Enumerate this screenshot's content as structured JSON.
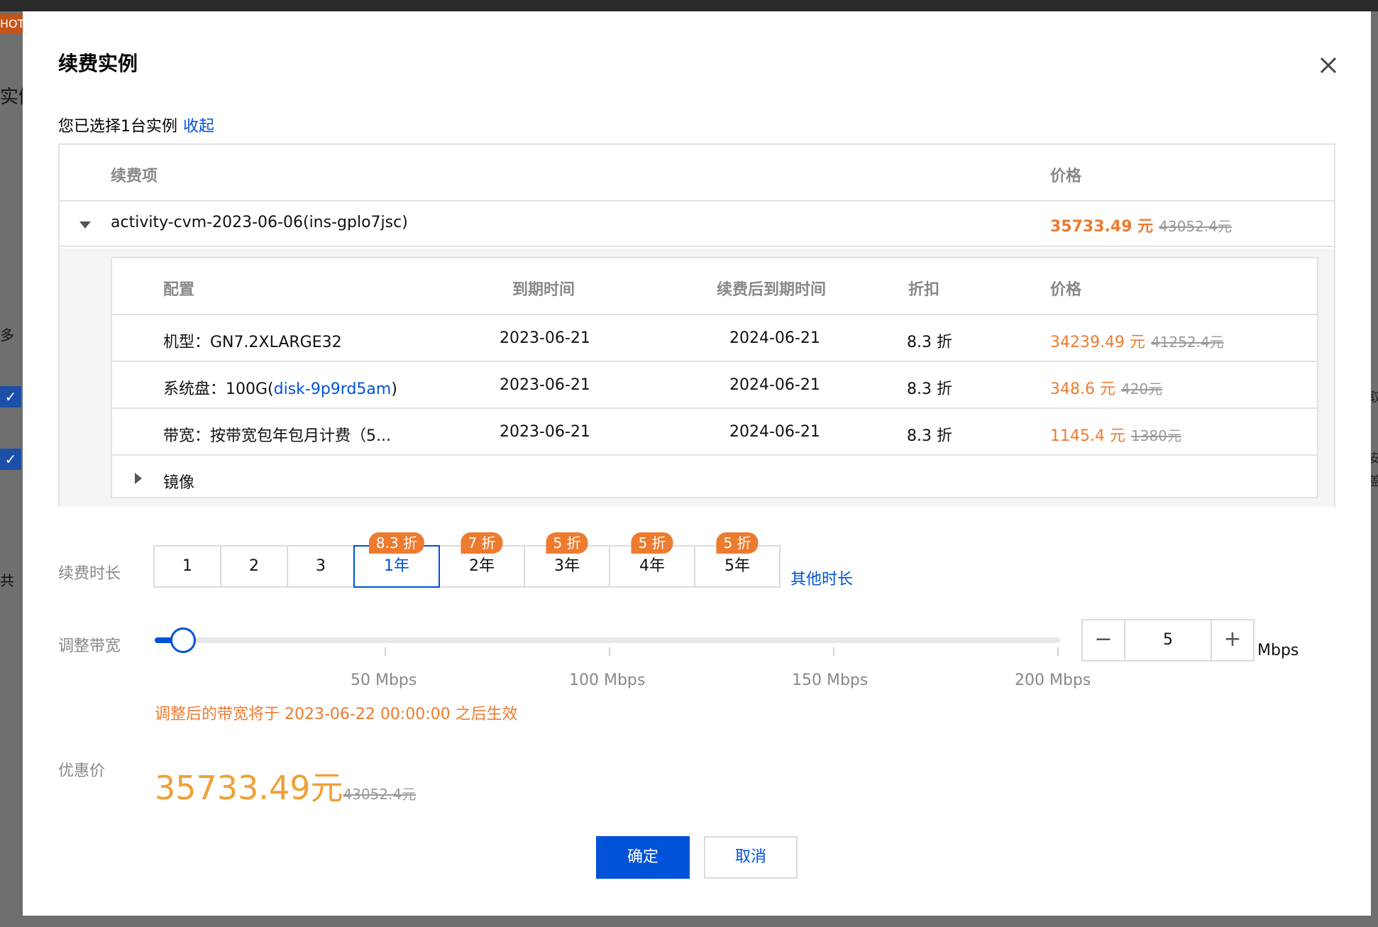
{
  "background": {
    "hot_label": "HOT",
    "left_texts": [
      "实例",
      "多",
      "共"
    ],
    "right_texts": [
      "取",
      "安",
      "盖"
    ]
  },
  "dialog": {
    "title": "续费实例",
    "selected_text": "您已选择1台实例",
    "collapse_link": "收起"
  },
  "outer_table": {
    "col_item": "续费项",
    "col_price": "价格",
    "instance": {
      "name": "activity-cvm-2023-06-06(ins-gplo7jsc)",
      "price": "35733.49 元",
      "orig_price": "43052.4元"
    }
  },
  "inner_table": {
    "headers": {
      "config": "配置",
      "expire": "到期时间",
      "new_expire": "续费后到期时间",
      "discount": "折扣",
      "price": "价格"
    },
    "rows": [
      {
        "config": "机型：GN7.2XLARGE32",
        "expire": "2023-06-21",
        "new_expire": "2024-06-21",
        "discount": "8.3 折",
        "price": "34239.49 元",
        "orig": "41252.4元"
      },
      {
        "config_prefix": "系统盘：100G(",
        "config_link": "disk-9p9rd5am",
        "config_suffix": ")",
        "expire": "2023-06-21",
        "new_expire": "2024-06-21",
        "discount": "8.3 折",
        "price": "348.6 元",
        "orig": "420元"
      },
      {
        "config": "带宽：按带宽包年包月计费（5...",
        "expire": "2023-06-21",
        "new_expire": "2024-06-21",
        "discount": "8.3 折",
        "price": "1145.4 元",
        "orig": "1380元"
      }
    ],
    "image_row": "镜像"
  },
  "duration": {
    "label": "续费时长",
    "options": [
      {
        "label": "1",
        "badge": ""
      },
      {
        "label": "2",
        "badge": ""
      },
      {
        "label": "3",
        "badge": ""
      },
      {
        "label": "1年",
        "badge": "8.3 折",
        "active": true
      },
      {
        "label": "2年",
        "badge": "7 折"
      },
      {
        "label": "3年",
        "badge": "5 折"
      },
      {
        "label": "4年",
        "badge": "5 折"
      },
      {
        "label": "5年",
        "badge": "5 折"
      }
    ],
    "other": "其他时长"
  },
  "bandwidth": {
    "label": "调整带宽",
    "marks": [
      "50 Mbps",
      "100 Mbps",
      "150 Mbps",
      "200 Mbps"
    ],
    "min": 0,
    "max": 200,
    "value": 5,
    "value_text": "5",
    "unit": "Mbps",
    "minus": "−",
    "plus": "+",
    "note": "调整后的带宽将于 2023-06-22 00:00:00 之后生效"
  },
  "total": {
    "label": "优惠价",
    "price": "35733.49元",
    "orig": "43052.4元"
  },
  "buttons": {
    "confirm": "确定",
    "cancel": "取消"
  },
  "colors": {
    "primary": "#0052d9",
    "orange": "#ed7b2f",
    "gold": "#f0a037"
  }
}
